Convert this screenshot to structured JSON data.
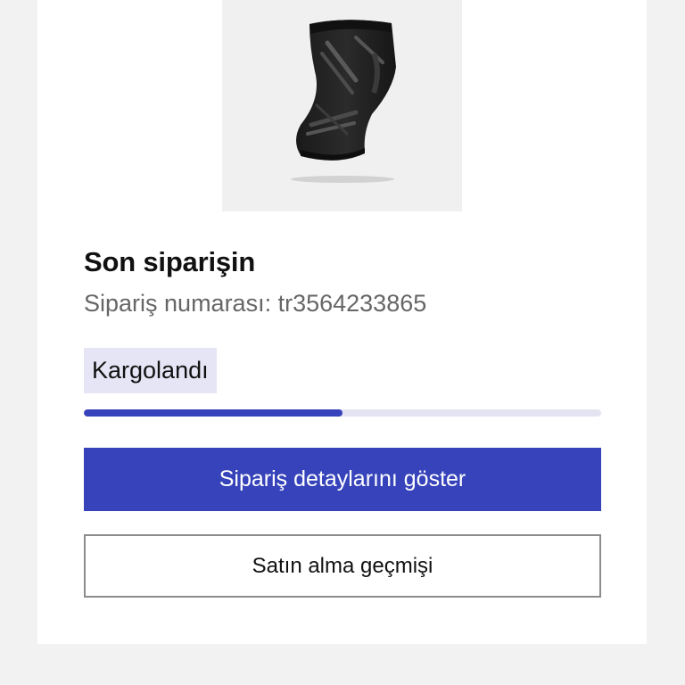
{
  "order": {
    "title": "Son siparişin",
    "order_number": "Sipariş numarası: tr3564233865",
    "status_label": "Kargolandı",
    "progress_fraction": 0.5
  },
  "actions": {
    "details_label": "Sipariş detaylarını göster",
    "history_label": "Satın alma geçmişi"
  },
  "colors": {
    "accent": "#3643ba",
    "badge_bg": "#e5e5f5",
    "progress_track": "#e3e3f2",
    "page_bg": "#f2f2f2"
  },
  "product": {
    "image_icon": "knee-sleeve-product-image"
  }
}
